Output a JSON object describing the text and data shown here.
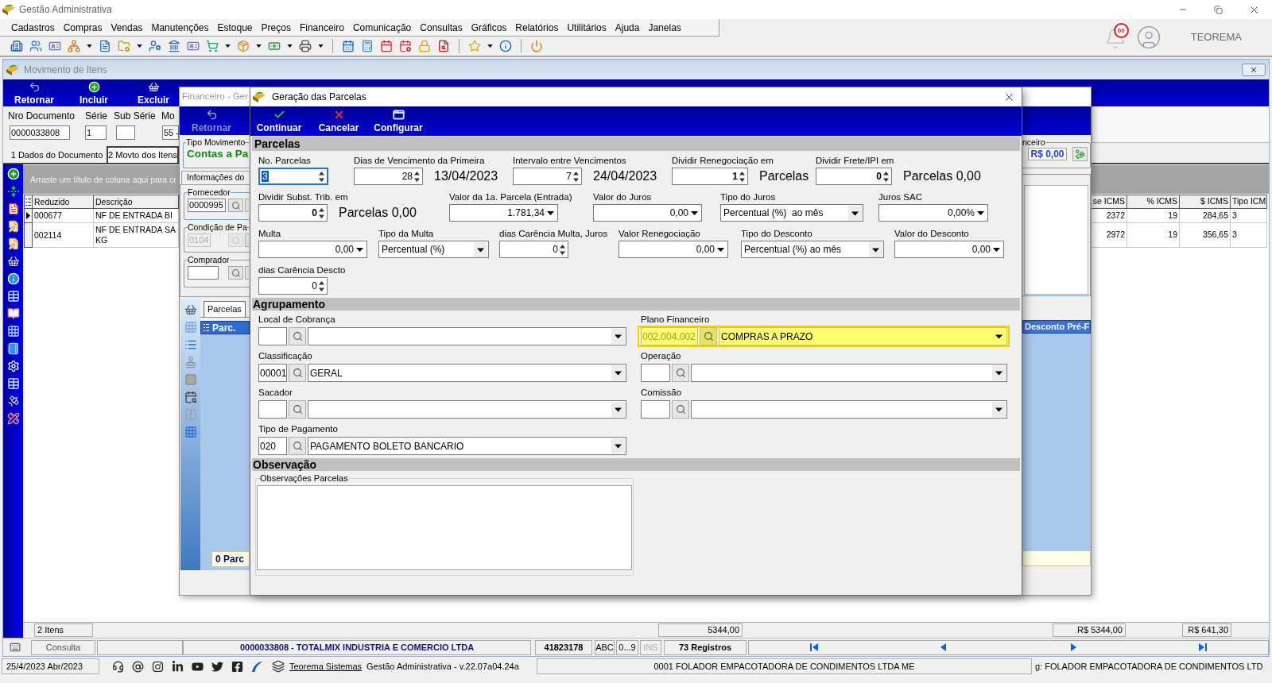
{
  "app": {
    "title": "Gestão Administrativa",
    "menu": [
      "Cadastros",
      "Compras",
      "Vendas",
      "Manutenções",
      "Estoque",
      "Preços",
      "Financeiro",
      "Comunicação",
      "Consultas",
      "Gráficos",
      "Relatórios",
      "Utilitários",
      "Ajuda",
      "Janelas"
    ],
    "notification_count": "00",
    "user": "TEOREMA"
  },
  "items_window": {
    "title": "Movimento de Itens",
    "toolbar": [
      "Retornar",
      "Incluir",
      "Excluir"
    ],
    "fields": [
      {
        "label": "Nro Documento",
        "value": "0000033808"
      },
      {
        "label": "Série",
        "value": "1"
      },
      {
        "label": "Sub Série"
      },
      {
        "label": "Mo",
        "value": "55 -"
      }
    ],
    "tabs": [
      {
        "label": "1 Dados do Documento",
        "selected": false
      },
      {
        "label": "2 Movto dos Itens",
        "selected": true
      }
    ],
    "group_hint": "Arraste um título de coluna aqui para cr",
    "grid": {
      "columns": [
        "Reduzido",
        "Descrição",
        "se ICMS",
        "% ICMS",
        "$ ICMS",
        "Tipo ICM"
      ],
      "rows": [
        {
          "current": true,
          "cells": [
            "000677",
            "NF DE ENTRADA BI",
            "2372",
            "19",
            "284,65",
            "3"
          ]
        },
        {
          "current": false,
          "cells": [
            "002114",
            "NF DE ENTRADA SA\nKG",
            "2972",
            "19",
            "356,65",
            "3"
          ]
        }
      ],
      "footer": [
        "2 Itens",
        "5344,00",
        "R$ 5344,00",
        "R$ 641,30"
      ]
    },
    "status_bar": {
      "mode": "Consulta",
      "document": "0000033808 - TOTALMIX INDUSTRIA E COMERCIO LTDA",
      "code": "41823178",
      "indicators": [
        {
          "label": "ABC",
          "active": true
        },
        {
          "label": "0...9",
          "active": true
        },
        {
          "label": "INS",
          "active": false
        }
      ],
      "records": "73 Registros"
    }
  },
  "financeiro_window": {
    "title": "Financeiro - Ger",
    "toolbar": [
      {
        "label": "Retornar",
        "disabled": true
      }
    ],
    "movement_type": {
      "label": "Tipo Movimento",
      "value": "Contas a Pa"
    },
    "info_tab": "Informações do",
    "lookups": [
      {
        "label": "Fornecedor",
        "code": "0000995",
        "disabled": false
      },
      {
        "label": "Condição de Pa",
        "code": "0104",
        "disabled": true
      },
      {
        "label": "Comprador",
        "disabled": false
      }
    ],
    "tabs": [
      {
        "label": "Parcelas",
        "selected": true
      }
    ],
    "installments_grid": {
      "column": "Parc.",
      "footer": "0 Parc"
    },
    "total": {
      "label": "nceiro",
      "value": "R$ 0,00"
    },
    "discount_grid": {
      "column": "Desconto Pré-F"
    }
  },
  "dialog": {
    "title": "Geração das Parcelas",
    "toolbar": [
      "Continuar",
      "Cancelar",
      "Configurar"
    ],
    "installments": {
      "title": "Parcelas",
      "rows": [
        [
          {
            "label": "No. Parcelas",
            "kind": "spin",
            "value": "3",
            "focused": true,
            "bold": false
          },
          {
            "label": "Dias de Vencimento da Primeira",
            "kind": "spin",
            "value": "28",
            "focused": false,
            "bold": false,
            "suffix": "13/04/2023"
          },
          {
            "label": "Intervalo entre Vencimentos",
            "kind": "spin",
            "value": "7",
            "focused": false,
            "bold": false,
            "suffix": "24/04/2023"
          },
          {
            "label": "Dividir Renegociação em",
            "kind": "spin",
            "value": "1",
            "focused": false,
            "bold": true,
            "suffix": "Parcelas"
          },
          {
            "label": "Dividir Frete/IPI em",
            "kind": "spin",
            "value": "0",
            "focused": false,
            "bold": true,
            "suffix": "Parcelas 0,00"
          }
        ],
        [
          {
            "label": "Dividir Subst. Trib. em",
            "kind": "spin",
            "value": "0",
            "focused": false,
            "bold": true,
            "suffix": "Parcelas 0,00"
          },
          {
            "label": "Valor da 1a. Parcela (Entrada)",
            "kind": "amount",
            "value": "1.781,34",
            "focused": false
          },
          {
            "label": "Valor do Juros",
            "kind": "amount",
            "value": "0,00",
            "focused": false
          },
          {
            "label": "Tipo do Juros",
            "kind": "select",
            "value": "Percentual (%)  ao mês",
            "focused": false
          },
          {
            "label": "Juros SAC",
            "kind": "amount",
            "value": "0,00%",
            "focused": false
          }
        ],
        [
          {
            "label": "Multa",
            "kind": "amount",
            "value": "0,00",
            "focused": false
          },
          {
            "label": "Tipo da Multa",
            "kind": "select",
            "value": "Percentual (%)",
            "focused": false
          },
          {
            "label": "dias Carência Multa, Juros",
            "kind": "spin",
            "value": "0",
            "focused": false,
            "bold": false
          },
          {
            "label": "Valor Renegociação",
            "kind": "amount",
            "value": "0,00",
            "focused": false
          },
          {
            "label": "Tipo do Desconto",
            "kind": "select",
            "value": "Percentual (%) ao mês",
            "focused": false
          },
          {
            "label": "Valor do Desconto",
            "kind": "amount",
            "value": "0,00",
            "focused": false
          }
        ],
        [
          {
            "label": "dias Carência Descto",
            "kind": "spin",
            "value": "0",
            "focused": false,
            "bold": false
          }
        ]
      ]
    },
    "grouping": {
      "title": "Agrupamento",
      "left": [
        {
          "label": "Local de Cobrança",
          "highlighted": false
        },
        {
          "label": "Classificação",
          "code": "00001",
          "value": "GERAL",
          "highlighted": false
        },
        {
          "label": "Sacador",
          "highlighted": false
        },
        {
          "label": "Tipo de Pagamento",
          "code": "020",
          "value": "PAGAMENTO BOLETO BANCARIO",
          "highlighted": false
        }
      ],
      "right": [
        {
          "label": "Plano Financeiro",
          "code": "002.004.002",
          "value": "COMPRAS A PRAZO",
          "highlighted": true
        },
        {
          "label": "Operação",
          "highlighted": false
        },
        {
          "label": "Comissão",
          "highlighted": false
        }
      ]
    },
    "notes": {
      "title": "Observação",
      "label": "Observações Parcelas"
    }
  },
  "bottom_bar": {
    "date": "25/4/2023 Abr/2023",
    "link": "Teorema Sistemas",
    "version": "Gestão Administrativa - v.22.07a04.24a",
    "company": "0001 FOLADOR EMPACOTADORA DE CONDIMENTOS LTDA ME",
    "login": "g: FOLADOR EMPACOTADORA DE CONDIMENTOS LTD"
  }
}
